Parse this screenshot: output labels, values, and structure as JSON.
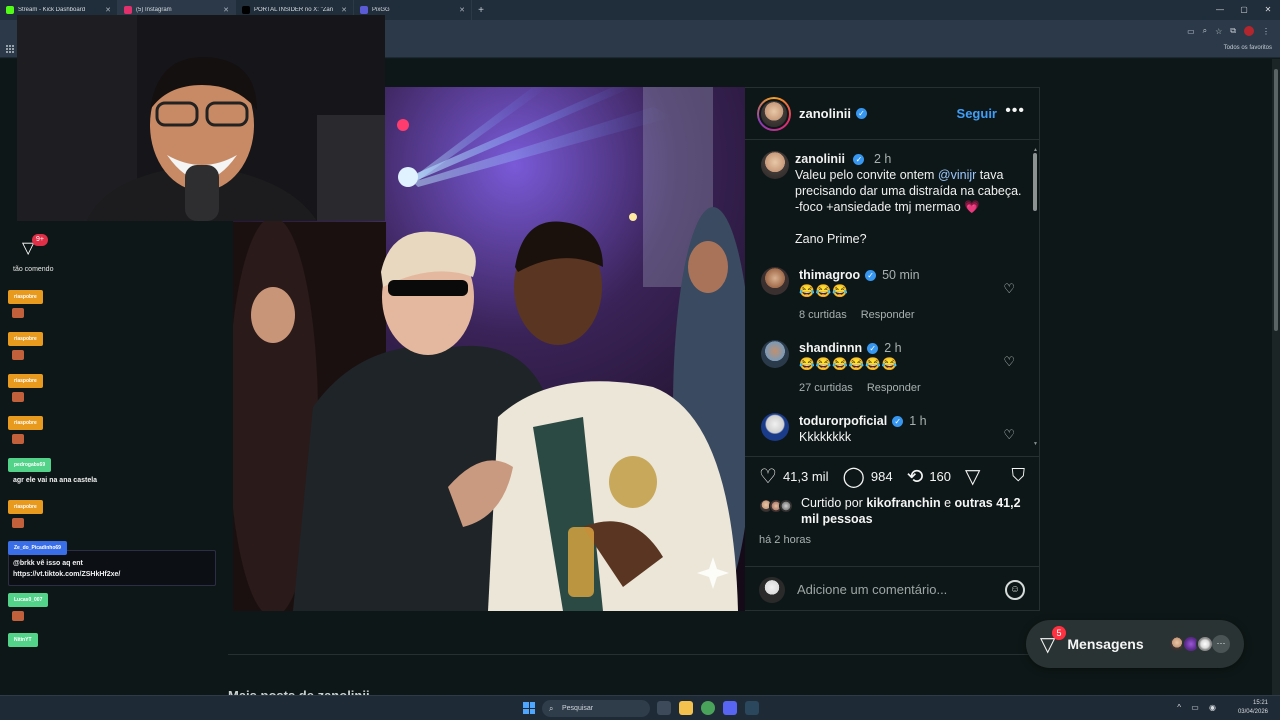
{
  "browser": {
    "tabs": [
      {
        "title": "Stream - Kick Dashboard",
        "color": "#53fc18"
      },
      {
        "title": "(5) Instagram",
        "color": "#e1306c"
      },
      {
        "title": "PORTAL INSIDER no X: \"Zan",
        "color": "#000000"
      },
      {
        "title": "PixGG",
        "color": "#5b5bd6"
      }
    ],
    "bookmarks_label": "Todos os favoritos"
  },
  "post": {
    "username": "zanolinii",
    "follow_label": "Seguir",
    "caption": {
      "username": "zanolinii",
      "time": "2 h",
      "text_before": "Valeu pelo convite ontem ",
      "mention": "@vinijr",
      "text_after": " tava precisando dar uma distraída na cabeça. -foco +ansiedade tmj mermao ",
      "heart": "💗",
      "line2": "Zano Prime?"
    },
    "comments": [
      {
        "username": "thimagroo",
        "time": "50 min",
        "text": "😂😂😂",
        "likes": "8 curtidas",
        "reply": "Responder"
      },
      {
        "username": "shandinnn",
        "time": "2 h",
        "text": "😂😂😂😂😂😂",
        "likes": "27 curtidas",
        "reply": "Responder"
      },
      {
        "username": "todurorpoficial",
        "time": "1 h",
        "text": "Kkkkkkkk"
      }
    ],
    "likes_count": "41,3 mil",
    "comments_count": "984",
    "reposts_count": "160",
    "liked_by_prefix": "Curtido por ",
    "liked_by_user": "kikofranchin",
    "liked_by_mid": " e ",
    "liked_by_others": "outras 41,2 mil pessoas",
    "posted_ago": "há 2 horas",
    "add_comment_placeholder": "Adicione um comentário..."
  },
  "more_from": "Mais posts de zanolinii",
  "messages": {
    "label": "Mensagens",
    "badge": "5"
  },
  "chat": {
    "badge": "9+",
    "notice": "tão comendo",
    "entries": [
      {
        "user": "riaspobre",
        "color": "#e89a1e"
      },
      {
        "user": "riaspobre",
        "color": "#e89a1e"
      },
      {
        "user": "riaspobre",
        "color": "#e89a1e"
      },
      {
        "user": "riaspobre",
        "color": "#e89a1e"
      },
      {
        "user": "pedrogabs69",
        "color": "#53d38a"
      },
      {
        "user": "riaspobre",
        "color": "#e89a1e"
      },
      {
        "user": "Ze_do_Picadinho69",
        "color": "#3a6ee8"
      },
      {
        "user": "Lucas0_007",
        "color": "#53d38a"
      },
      {
        "user": "NitinYT",
        "color": "#53d38a"
      }
    ],
    "msg_ana": "agr ele vai na ana castela",
    "msg_link_1": "@brkk vê isso aq ent",
    "msg_link_2": "https://vt.tiktok.com/ZSHkHf2xe/"
  },
  "taskbar": {
    "search_label": "Pesquisar",
    "time": "15:21",
    "date": "03/04/2026"
  },
  "icons": {
    "verified": "verified-badge-icon",
    "heart": "heart-icon",
    "comment": "comment-icon",
    "repost": "repost-icon",
    "share": "share-icon",
    "save": "bookmark-icon",
    "emoji": "emoji-icon",
    "messages": "messages-icon"
  }
}
